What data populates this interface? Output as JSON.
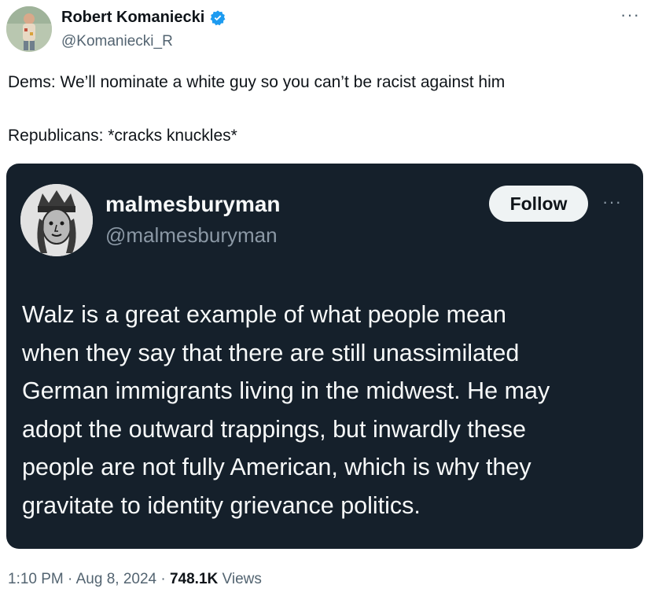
{
  "author": {
    "name": "Robert Komaniecki",
    "handle": "@Komaniecki_R"
  },
  "more_label": "···",
  "tweet": {
    "line1": "Dems: We’ll nominate a white guy so you can’t be racist against him",
    "line2": "Republicans: *cracks knuckles*"
  },
  "quoted": {
    "name": "malmesburyman",
    "handle": "@malmesburyman",
    "follow_label": "Follow",
    "more_label": "···",
    "body_lines": [
      "Walz is a great example of what people mean",
      "when they say that there are still unassimilated",
      "German immigrants living in the midwest. He may",
      "adopt the outward trappings, but inwardly these",
      "people are not fully American, which is why they",
      "gravitate to identity grievance politics."
    ]
  },
  "meta": {
    "time": "1:10 PM",
    "date": "Aug 8, 2024",
    "separator": "·",
    "views_count": "748.1K",
    "views_label": "Views"
  },
  "colors": {
    "verified_badge": "#1d9bf0",
    "embed_background": "#15202b"
  }
}
